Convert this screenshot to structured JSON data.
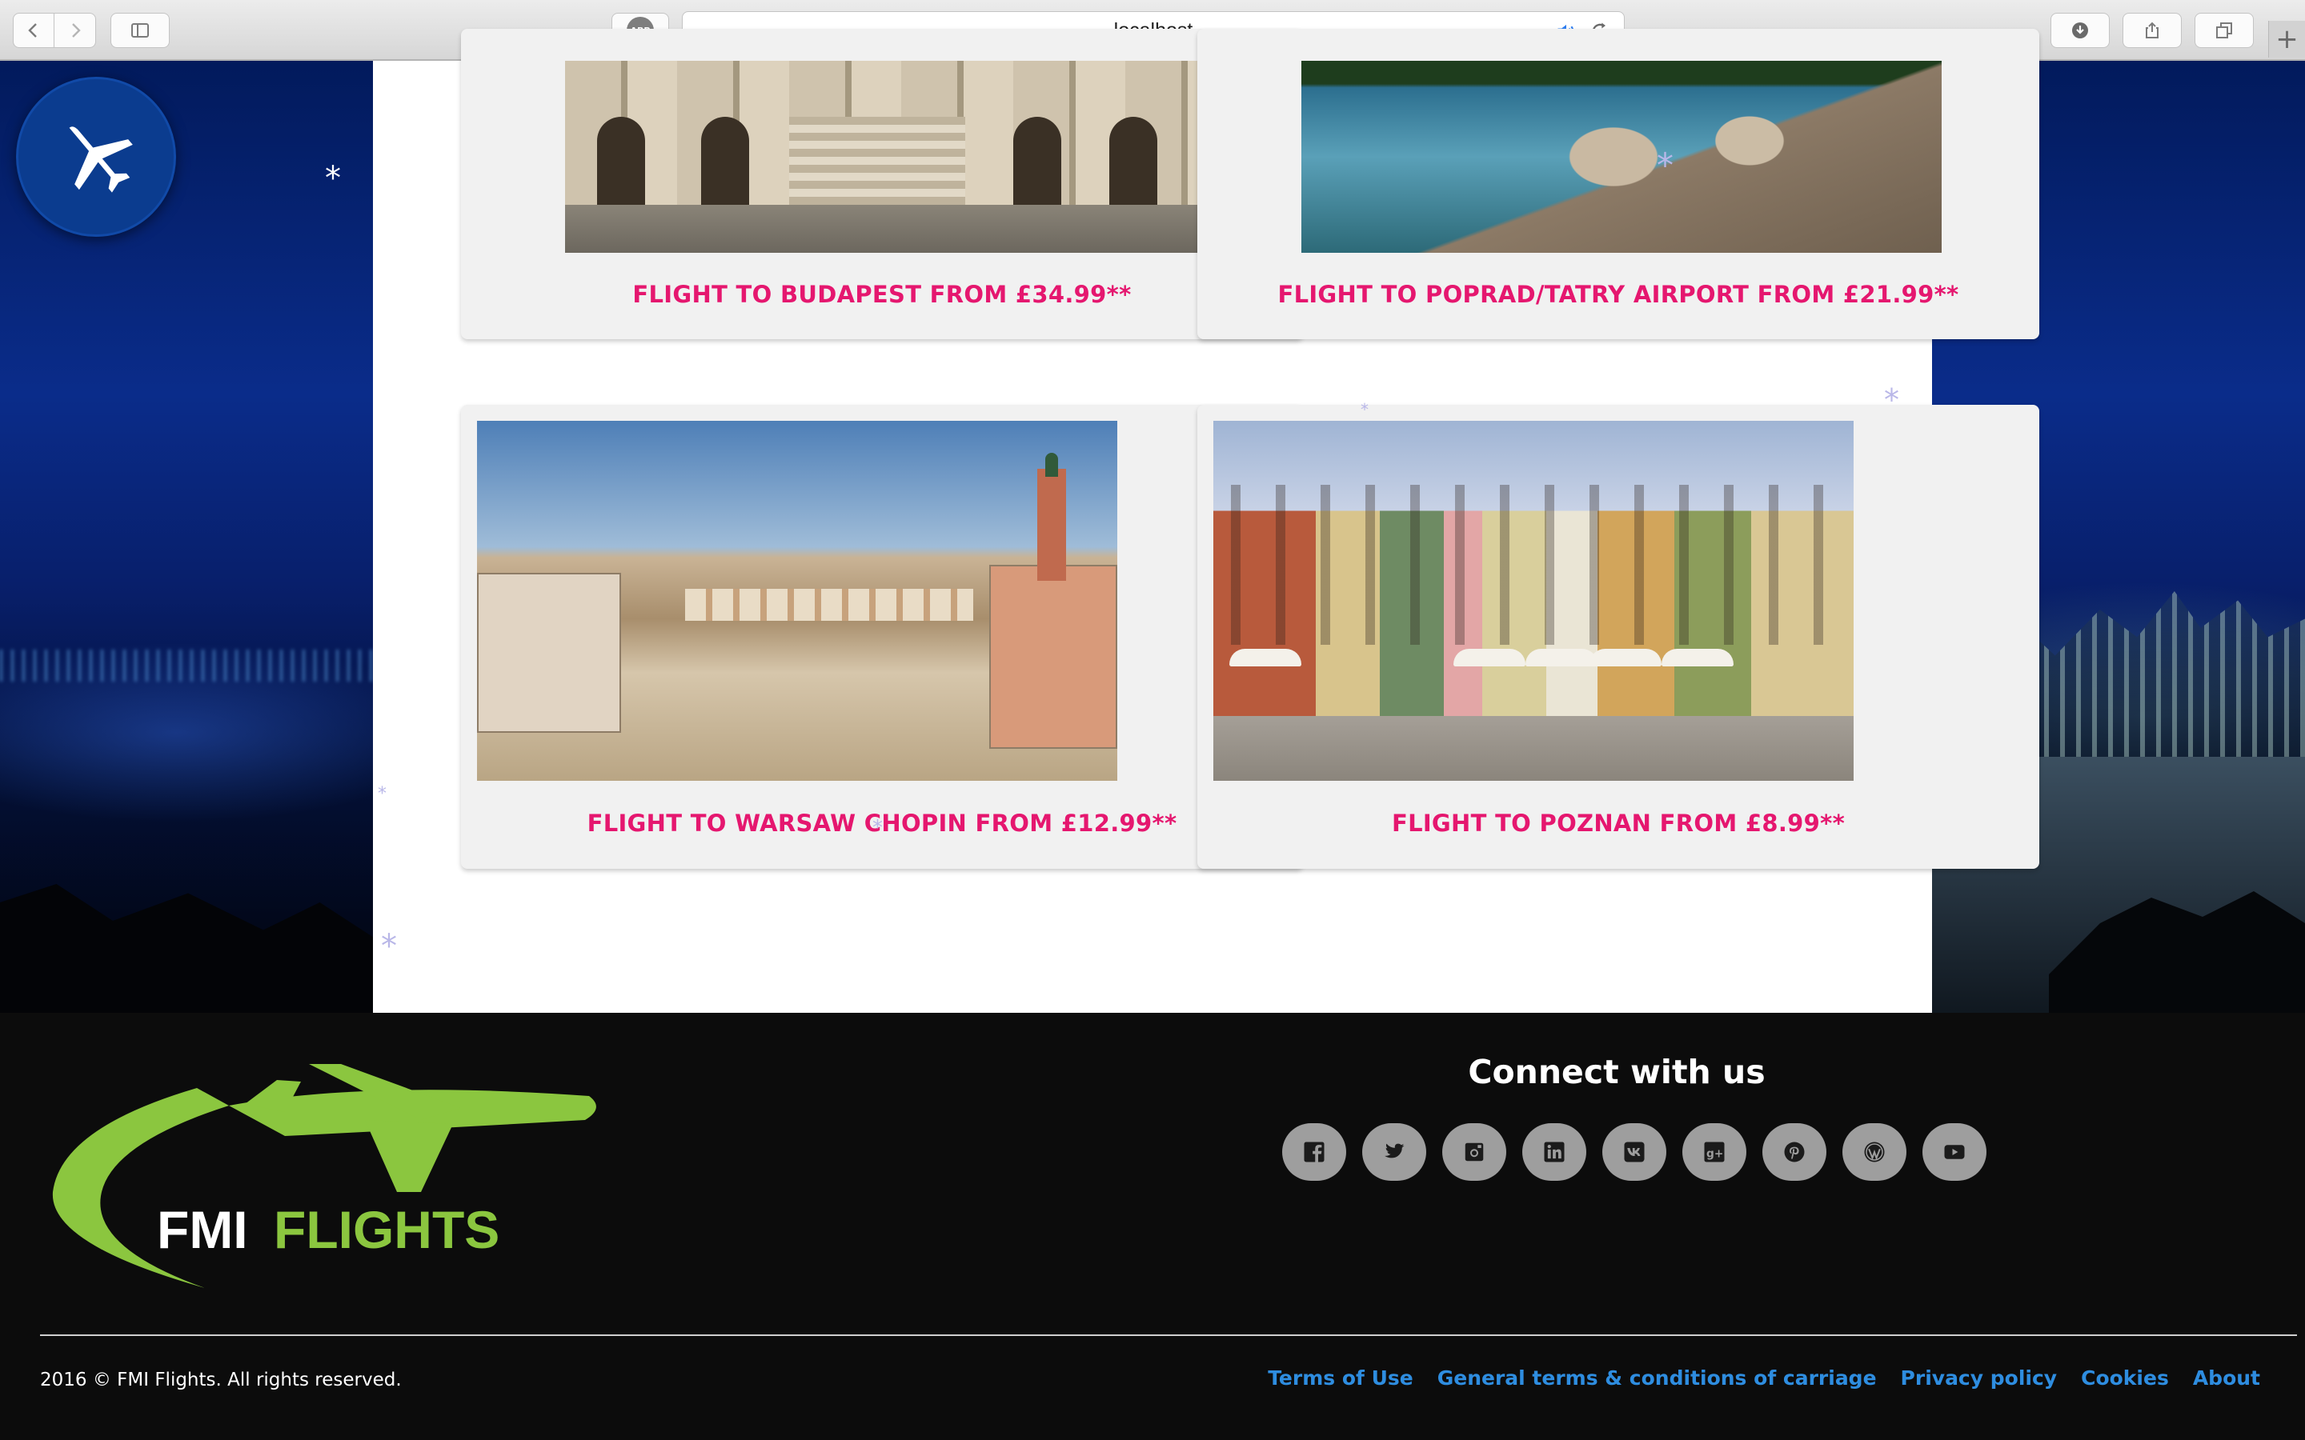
{
  "browser": {
    "url": "localhost",
    "adblock_label": "ABP",
    "new_tab_glyph": "+"
  },
  "icons": {
    "back": "chevron-left-icon",
    "forward": "chevron-right-icon",
    "sidebar": "sidebar-icon",
    "audio": "speaker-icon",
    "reload": "reload-icon",
    "downloads": "download-icon",
    "share": "share-icon",
    "tabs": "tabs-icon",
    "plane": "airplane-icon"
  },
  "flights": [
    {
      "caption": "FLIGHT TO BUDAPEST FROM £34.99**"
    },
    {
      "caption": "FLIGHT TO POPRAD/TATRY AIRPORT FROM £21.99**"
    },
    {
      "caption": "FLIGHT TO WARSAW CHOPIN FROM £12.99**"
    },
    {
      "caption": "FLIGHT TO POZNAN FROM £8.99**"
    }
  ],
  "snow_glyph": "*",
  "footer": {
    "logo": {
      "brand_white": "FMI",
      "brand_green": "FLIGHTS"
    },
    "connect_title": "Connect with us",
    "social": [
      "facebook",
      "twitter",
      "instagram",
      "linkedin",
      "vk",
      "google-plus",
      "pinterest",
      "wordpress",
      "youtube"
    ],
    "copyright": "2016 © FMI Flights. All rights reserved.",
    "links": [
      "Terms of Use",
      "General terms & conditions of carriage",
      "Privacy policy",
      "Cookies",
      "About"
    ]
  },
  "colors": {
    "accent_pink": "#e5176f",
    "link_blue": "#2e8de0",
    "logo_green": "#8bc63f",
    "fab_blue": "#0b3c8f",
    "social_grey": "#9e9e9e"
  }
}
